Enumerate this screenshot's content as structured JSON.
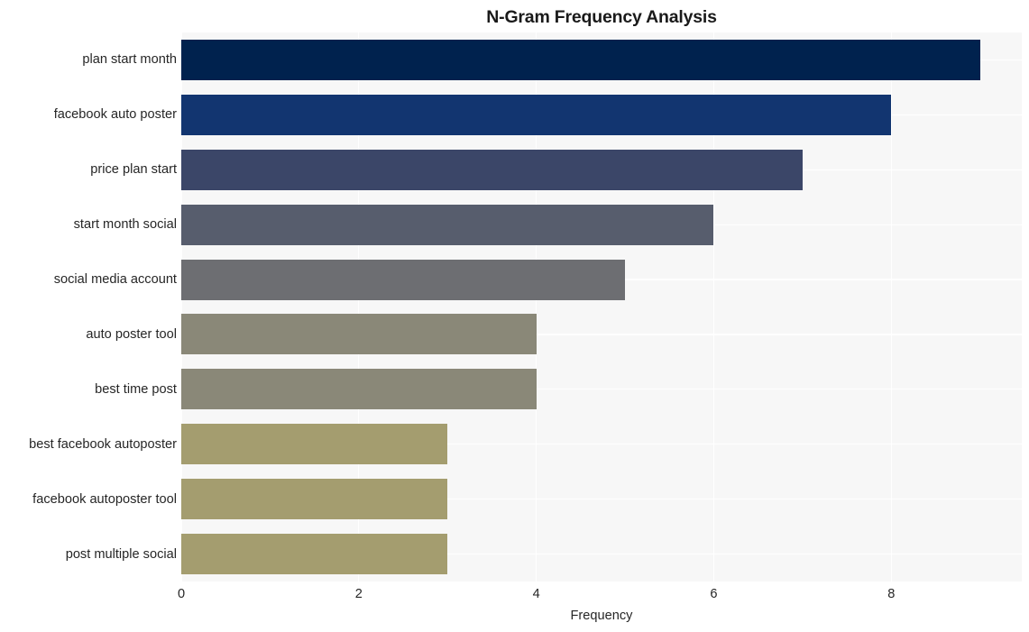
{
  "chart_data": {
    "type": "bar",
    "orientation": "horizontal",
    "title": "N-Gram Frequency Analysis",
    "xlabel": "Frequency",
    "ylabel": "",
    "categories": [
      "plan start month",
      "facebook auto poster",
      "price plan start",
      "start month social",
      "social media account",
      "auto poster tool",
      "best time post",
      "best facebook autoposter",
      "facebook autoposter tool",
      "post multiple social"
    ],
    "values": [
      9,
      8,
      7,
      6,
      5,
      4,
      4,
      3,
      3,
      3
    ],
    "bar_colors": [
      "#00224e",
      "#123570",
      "#3b4668",
      "#575d6d",
      "#6d6e72",
      "#8a8878",
      "#8a8878",
      "#a49d6f",
      "#a49d6f",
      "#a49d6f"
    ],
    "xlim": [
      0,
      9.47
    ],
    "xticks": [
      0,
      2,
      4,
      6,
      8
    ],
    "xtick_labels": [
      "0",
      "2",
      "4",
      "6",
      "8"
    ],
    "grid": true,
    "grid_color": "#ffffff",
    "plot_background": "#f7f7f7",
    "figure_background": "#ffffff",
    "legend": null,
    "colormap": "cividis"
  }
}
